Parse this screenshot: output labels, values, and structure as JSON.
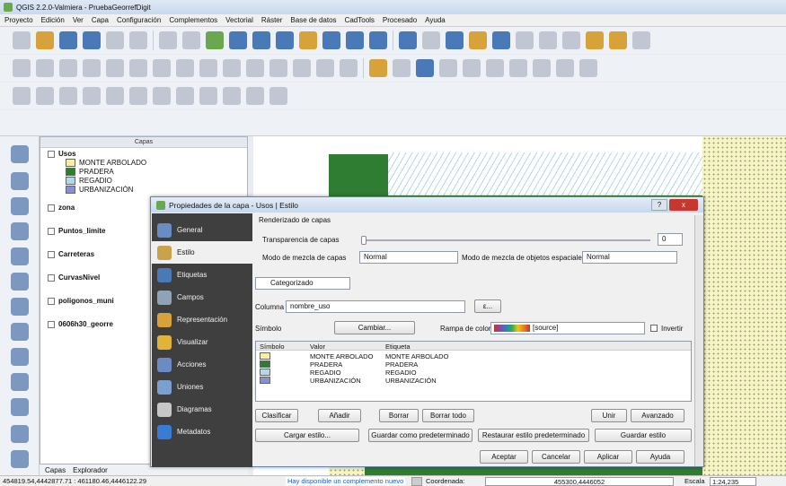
{
  "window": {
    "title": "QGIS 2.2.0-Valmiera - PruebaGeorrefDigit"
  },
  "menu": [
    "Proyecto",
    "Edición",
    "Ver",
    "Capa",
    "Configuración",
    "Complementos",
    "Vectorial",
    "Ráster",
    "Base de datos",
    "CadTools",
    "Procesado",
    "Ayuda"
  ],
  "layers_panel": {
    "title": "Capas",
    "layers": [
      {
        "name": "Usos",
        "children": [
          {
            "label": "MONTE ARBOLADO",
            "color": "#f5f0a8"
          },
          {
            "label": "PRADERA",
            "color": "#2e7d32"
          },
          {
            "label": "REGADIO",
            "color": "#b6d7e8"
          },
          {
            "label": "URBANIZACIÓN",
            "color": "#8a8fd1"
          }
        ]
      },
      {
        "name": "zona",
        "symbol_color": "#d9261c"
      },
      {
        "name": "Puntos_limite",
        "symbol_color": "#2e9c2e"
      },
      {
        "name": "Carreteras",
        "symbol_color": "#6fc04f"
      },
      {
        "name": "CurvasNivel",
        "symbol_color": "#f39c12"
      },
      {
        "name": "poligonos_muni"
      },
      {
        "name": "0606h30_georre"
      }
    ],
    "tabs": [
      "Capas",
      "Explorador"
    ]
  },
  "dialog": {
    "title": "Propiedades de la capa - Usos | Estilo",
    "help": "?",
    "close": "x",
    "sidebar": [
      "General",
      "Estilo",
      "Etiquetas",
      "Campos",
      "Representación",
      "Visualizar",
      "Acciones",
      "Uniones",
      "Diagramas",
      "Metadatos"
    ],
    "sidebar_icons": [
      "general-icon",
      "style-icon",
      "labels-icon",
      "fields-icon",
      "render-icon",
      "display-icon",
      "actions-icon",
      "joins-icon",
      "diagrams-icon",
      "metadata-icon"
    ],
    "sidebar_active": 1,
    "group_label": "Renderizado de capas",
    "transparency_label": "Transparencia de capas",
    "transparency_value": "0",
    "blend_label": "Modo de mezcla de capas",
    "blend_value": "Normal",
    "feature_blend_label": "Modo de mezcla de objetos espaciales",
    "feature_blend_value": "Normal",
    "renderer": "Categorizado",
    "column_label": "Columna",
    "column_value": "nombre_uso",
    "expression_button": "ε...",
    "symbol_label": "Símbolo",
    "change_button": "Cambiar...",
    "ramp_label": "Rampa de color",
    "ramp_value": "[source]",
    "invert_label": "Invertir",
    "table_headers": [
      "Símbolo",
      "Valor",
      "Etiqueta"
    ],
    "rows": [
      {
        "value": "MONTE ARBOLADO",
        "label": "MONTE ARBOLADO",
        "color": "#f5f0a8"
      },
      {
        "value": "PRADERA",
        "label": "PRADERA",
        "color": "#2e7d32"
      },
      {
        "value": "REGADIO",
        "label": "REGADIO",
        "color": "#b6d7e8"
      },
      {
        "value": "URBANIZACIÓN",
        "label": "URBANIZACIÓN",
        "color": "#8a8fd1"
      }
    ],
    "buttons_row1": {
      "classify": "Clasificar",
      "add": "Añadir",
      "delete": "Borrar",
      "delete_all": "Borrar todo",
      "join": "Unir",
      "advanced": "Avanzado"
    },
    "buttons_row2": {
      "load": "Cargar estilo...",
      "save_default": "Guardar como predeterminado",
      "restore": "Restaurar estilo predeterminado",
      "save": "Guardar estilo"
    },
    "footer": {
      "ok": "Aceptar",
      "cancel": "Cancelar",
      "apply": "Aplicar",
      "help": "Ayuda"
    }
  },
  "status": {
    "coords_left": "454819.54,4442877.71 : 461180.46,4446122.29",
    "update_link": "Hay disponible un complemento nuevo",
    "coord_label": "Coordenada:",
    "coord_value": "455300,4446052",
    "scale_label": "Escala",
    "scale_value": "1:24,235"
  }
}
